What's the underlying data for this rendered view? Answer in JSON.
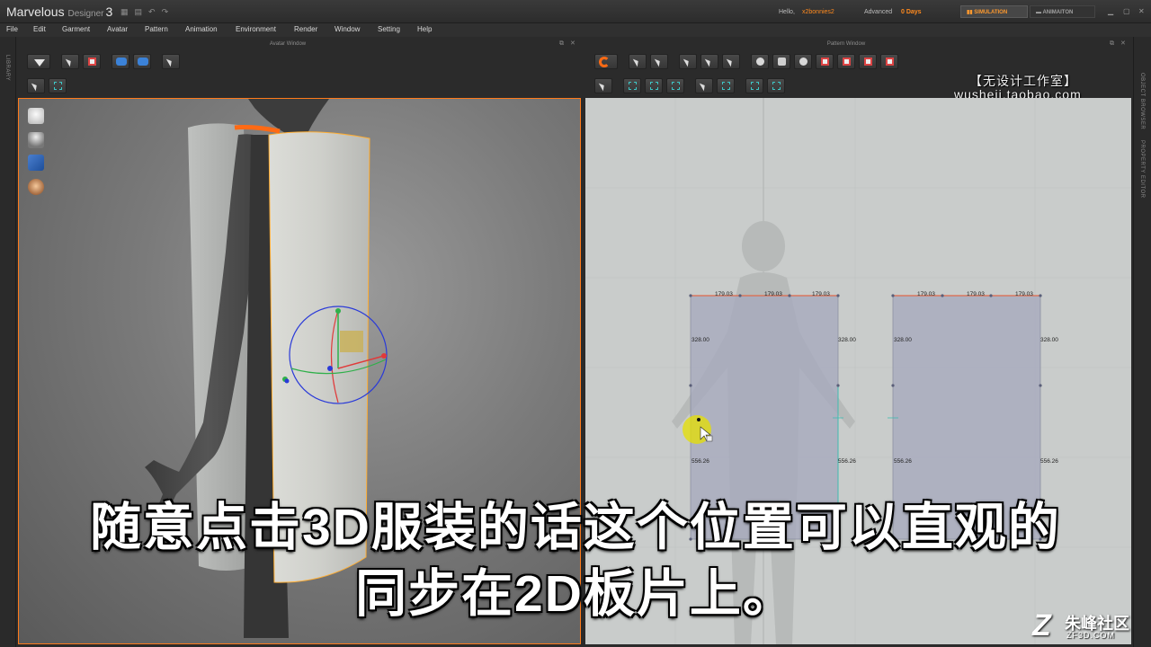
{
  "app": {
    "name": "Marvelous",
    "sub": "Designer",
    "version": "3",
    "hello_label": "Hello,",
    "username": "x2bonnies2",
    "license": "Advanced",
    "days": "0 Days",
    "modes": {
      "simulation": "SIMULATION",
      "animation": "ANIMAITON"
    }
  },
  "menu": [
    "File",
    "Edit",
    "Garment",
    "Avatar",
    "Pattern",
    "Animation",
    "Environment",
    "Render",
    "Window",
    "Setting",
    "Help"
  ],
  "side": {
    "left_label": "LIBRARY",
    "right_top_label": "OBJECT BROWSER",
    "right_bottom_label": "PROPERTY EDITOR"
  },
  "panels": {
    "avatar_window": "Avatar Window",
    "pattern_window": "Pattern Window"
  },
  "watermark": {
    "line1": "【无设计工作室】",
    "line2": "wusheji.taobao.com"
  },
  "pattern": {
    "top_edges": [
      "179.03",
      "179.03",
      "179.03",
      "179.03",
      "179.03",
      "179.03"
    ],
    "sides": [
      "328.00",
      "328.00",
      "328.00",
      "328.00"
    ],
    "lower_sides": [
      "556.26",
      "556.26",
      "556.26",
      "556.26"
    ]
  },
  "subtitle": {
    "line1": "随意点击3D服装的话这个位置可以直观的",
    "line2": "同步在2D板片上。"
  },
  "corner_logo": {
    "mark": "Z",
    "name": "朱峰社区",
    "site": "ZF3D.COM"
  },
  "colors": {
    "accent": "#ff7a1a",
    "pattern_fill": "#a7aabe",
    "pattern_bg": "#c9cccb"
  }
}
